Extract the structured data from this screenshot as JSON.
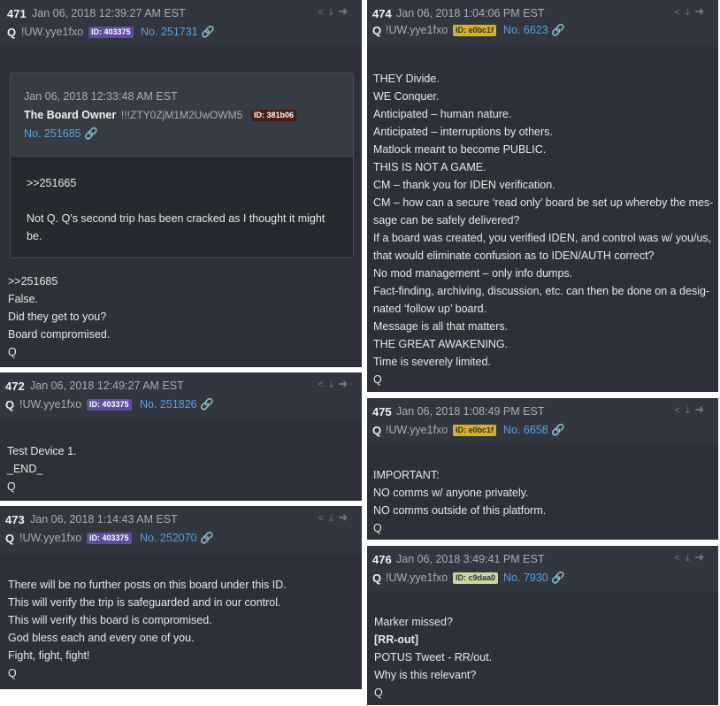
{
  "icons": [
    "share-icon",
    "download-icon",
    "goto-icon"
  ],
  "posts": [
    {
      "num": "471",
      "date": "Jan 06, 2018 12:39:27 AM EST",
      "author": "Q",
      "trip": "!UW.yye1fxo",
      "id_badge": "ID: 403375",
      "post_no": "No. 251731",
      "quote": {
        "date": "Jan 06, 2018 12:33:48 AM EST",
        "author": "The Board Owner",
        "trip": "!!!ZTY0ZjM1M2UwOWM5",
        "id_badge": "ID: 381b06",
        "post_no": "No. 251685",
        "lines": [
          ">>251665",
          "Not Q. Q's second trip has been cracked as I thought it might",
          "be."
        ]
      },
      "lines": [
        ">>251685",
        "False.",
        "Did they get to you?",
        "Board compromised.",
        "Q"
      ]
    },
    {
      "num": "472",
      "date": "Jan 06, 2018 12:49:27 AM EST",
      "author": "Q",
      "trip": "!UW.yye1fxo",
      "id_badge": "ID: 403375",
      "post_no": "No. 251826",
      "lines": [
        "Test Device 1.",
        "_END_",
        "Q"
      ]
    },
    {
      "num": "473",
      "date": "Jan 06, 2018 1:14:43 AM EST",
      "author": "Q",
      "trip": "!UW.yye1fxo",
      "id_badge": "ID: 403375",
      "post_no": "No. 252070",
      "lines": [
        "There will be no further posts on this board under this ID.",
        "This will verify the trip is safeguarded and in our control.",
        "This will verify this board is compromised.",
        "God bless each and every one of you.",
        "Fight, fight, fight!",
        "Q"
      ]
    },
    {
      "num": "474",
      "date": "Jan 06, 2018 1:04:06 PM EST",
      "author": "Q",
      "trip": "!UW.yye1fxo",
      "id_badge": "ID: e0bc1f",
      "post_no": "No. 6623",
      "lines": [
        "THEY Divide.",
        "WE Conquer.",
        "Anticipated – human nature.",
        "Anticipated – interruptions by others.",
        "Matlock meant to become PUBLIC.",
        "THIS IS NOT A GAME.",
        "CM – thank you for IDEN verification.",
        "CM – how can a secure ‘read only’ board be set up whereby the mes-",
        "sage can be safely delivered?",
        "If a board was created, you verified IDEN, and control was w/ you/us,",
        "that would eliminate confusion as to IDEN/AUTH correct?",
        "No mod management – only info dumps.",
        "Fact-finding, archiving, discussion, etc. can then be done on a desig-",
        "nated ‘follow up’ board.",
        "Message is all that matters.",
        "THE GREAT AWAKENING.",
        "Time is severely limited.",
        "Q"
      ]
    },
    {
      "num": "475",
      "date": "Jan 06, 2018 1:08:49 PM EST",
      "author": "Q",
      "trip": "!UW.yye1fxo",
      "id_badge": "ID: e0bc1f",
      "post_no": "No. 6658",
      "lines": [
        "IMPORTANT:",
        "NO comms w/ anyone privately.",
        "NO comms outside of this platform.",
        "Q"
      ]
    },
    {
      "num": "476",
      "date": "Jan 06, 2018 3:49:41 PM EST",
      "author": "Q",
      "trip": "!UW.yye1fxo",
      "id_badge": "ID: c9daa0",
      "post_no": "No. 7930",
      "lines": [
        "Marker missed?",
        "[RR-out]",
        "POTUS Tweet - RR/out.",
        "Why is this relevant?",
        "Q"
      ]
    }
  ]
}
